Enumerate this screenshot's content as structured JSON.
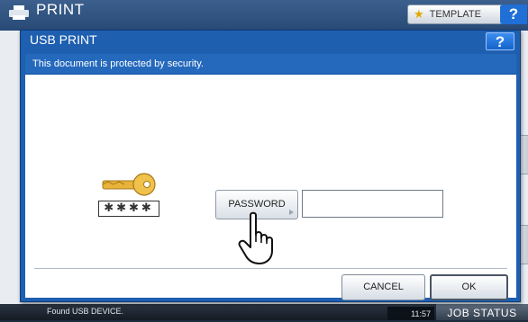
{
  "background": {
    "app_title": "PRINT",
    "template_label": "TEMPLATE",
    "help_label": "?",
    "status_message": "Found USB DEVICE.",
    "clock": "11:57",
    "job_status_label": "JOB STATUS"
  },
  "dialog": {
    "title": "USB PRINT",
    "help_label": "?",
    "message": "This document is protected by security.",
    "key_mask": "✱✱✱✱",
    "password_button_label": "PASSWORD",
    "password_value": "",
    "cancel_label": "CANCEL",
    "ok_label": "OK"
  },
  "colors": {
    "dialog_blue": "#1e5fb0",
    "key_gold": "#e8b33a",
    "help_blue": "#1f6fd6"
  }
}
